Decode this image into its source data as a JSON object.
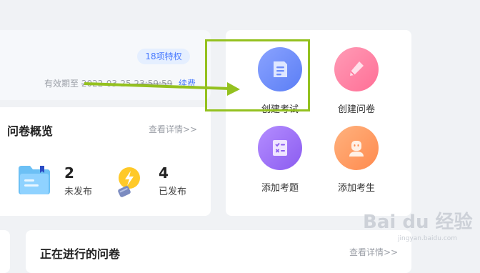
{
  "membership": {
    "badge": "18项特权",
    "validity_prefix": "有效期至",
    "validity_date": "2022-03-25 23:59:59",
    "renew_label": "续费"
  },
  "overview": {
    "title": "问卷概览",
    "detail_link": "查看详情>>",
    "unpublished": {
      "count": "2",
      "label": "未发布"
    },
    "published": {
      "count": "4",
      "label": "已发布"
    }
  },
  "actions": {
    "create_exam": "创建考试",
    "create_survey": "创建问卷",
    "add_question": "添加考题",
    "add_examinee": "添加考生"
  },
  "ongoing": {
    "title": "正在进行的问卷",
    "detail_link": "查看详情>>"
  },
  "watermark": {
    "text": "Bai du 经验",
    "sub": "jingyan.baidu.com"
  },
  "colors": {
    "accent": "#4a7bff",
    "annotation_green": "#94c11f",
    "exam_icon": "#6e8dfb",
    "survey_icon": "#ff7fa0",
    "question_icon": "#9c6cf5",
    "examinee_icon": "#ff9b62"
  }
}
